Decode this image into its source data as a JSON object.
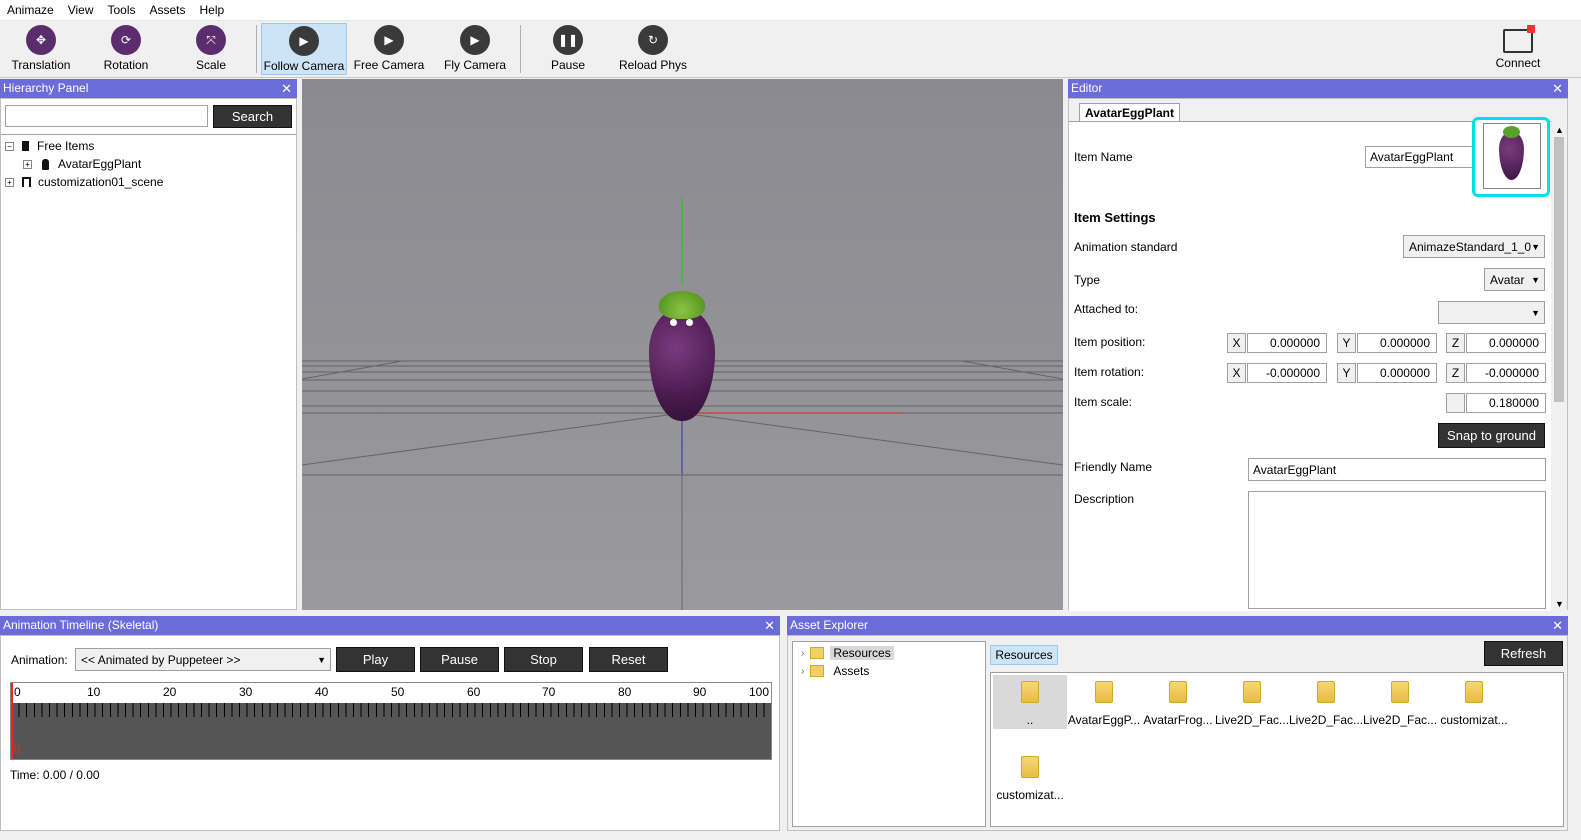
{
  "menu": [
    "Animaze",
    "View",
    "Tools",
    "Assets",
    "Help"
  ],
  "toolbar": {
    "translation": "Translation",
    "rotation": "Rotation",
    "scale": "Scale",
    "follow_camera": "Follow Camera",
    "free_camera": "Free Camera",
    "fly_camera": "Fly Camera",
    "pause": "Pause",
    "reload_phys": "Reload Phys",
    "connect": "Connect"
  },
  "hierarchy": {
    "title": "Hierarchy Panel",
    "search_btn": "Search",
    "search_value": "",
    "items": [
      "Free Items",
      "AvatarEggPlant",
      "customization01_scene"
    ]
  },
  "editor": {
    "title": "Editor",
    "tab": "AvatarEggPlant",
    "item_name_label": "Item Name",
    "item_name": "AvatarEggPlant",
    "item_settings": "Item Settings",
    "animation_standard_label": "Animation standard",
    "animation_standard": "AnimazeStandard_1_0",
    "type_label": "Type",
    "type": "Avatar",
    "attached_label": "Attached to:",
    "attached": "",
    "position_label": "Item position:",
    "rotation_label": "Item rotation:",
    "scale_label": "Item scale:",
    "axes": [
      "X",
      "Y",
      "Z"
    ],
    "position": [
      "0.000000",
      "0.000000",
      "0.000000"
    ],
    "rotation": [
      "-0.000000",
      "0.000000",
      "-0.000000"
    ],
    "scale": "0.180000",
    "snap": "Snap to ground",
    "friendly_label": "Friendly Name",
    "friendly": "AvatarEggPlant",
    "description_label": "Description",
    "description": ""
  },
  "timeline": {
    "title": "Animation Timeline (Skeletal)",
    "animation_label": "Animation:",
    "animation": "<< Animated by Puppeteer >>",
    "play": "Play",
    "pause": "Pause",
    "stop": "Stop",
    "reset": "Reset",
    "ticks": [
      "0",
      "10",
      "20",
      "30",
      "40",
      "50",
      "60",
      "70",
      "80",
      "90",
      "100"
    ],
    "cursor": "0",
    "time": "Time: 0.00 / 0.00"
  },
  "assets": {
    "title": "Asset Explorer",
    "refresh": "Refresh",
    "tree": [
      "Resources",
      "Assets"
    ],
    "crumb": "Resources",
    "folders": [
      "..",
      "AvatarEggP...",
      "AvatarFrog...",
      "Live2D_Fac...",
      "Live2D_Fac...",
      "Live2D_Fac...",
      "customizat...",
      "customizat..."
    ]
  },
  "colors": {
    "panel_title": "#6b6bd9",
    "viewport": "#8e8d93",
    "eggplant": "#4a1a4e",
    "leaf": "#5aa02c",
    "highlight": "#00e0e8"
  }
}
